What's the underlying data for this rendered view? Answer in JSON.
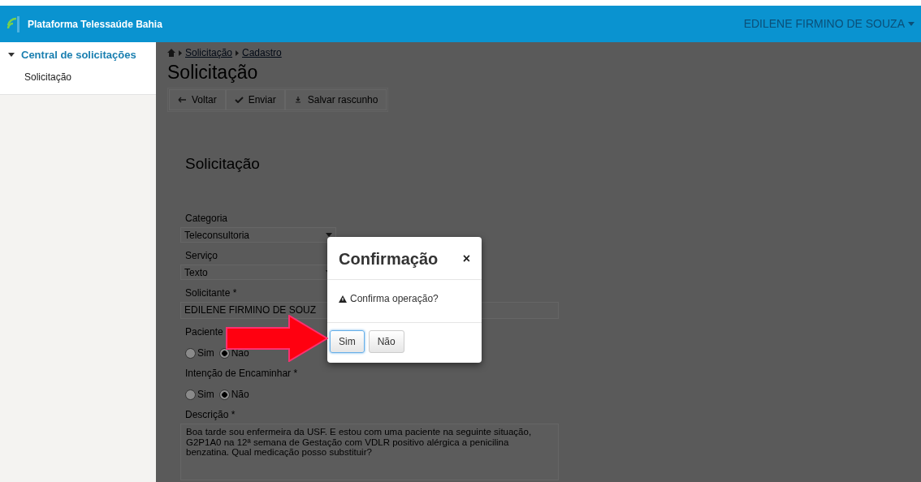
{
  "navbar": {
    "brand": "Plataforma Telessaúde Bahia",
    "user": "EDILENE FIRMINO DE SOUZA"
  },
  "sidebar": {
    "items": [
      {
        "label": "Central de solicitações",
        "expanded": true,
        "children": [
          {
            "label": "Solicitação"
          }
        ]
      }
    ]
  },
  "breadcrumb": [
    "Solicitação",
    "Cadastro"
  ],
  "page_title": "Solicitação",
  "toolbar": [
    {
      "kind": "back",
      "label": "Voltar"
    },
    {
      "kind": "send",
      "label": "Enviar"
    },
    {
      "kind": "save",
      "label": "Salvar rascunho"
    }
  ],
  "form": {
    "title": "Solicitação",
    "fields": [
      {
        "kind": "select",
        "label": "Categoria",
        "value": "Teleconsultoria"
      },
      {
        "kind": "select",
        "label": "Serviço",
        "value": "Texto"
      },
      {
        "kind": "text",
        "label": "Solicitante *",
        "value": "EDILENE FIRMINO DE SOUZ"
      },
      {
        "kind": "radio",
        "label": "Paciente",
        "options": [
          {
            "label": "Sim",
            "selected": false
          },
          {
            "label": "Não",
            "selected": true
          }
        ]
      },
      {
        "kind": "radio",
        "label": "Intenção de Encaminhar *",
        "options": [
          {
            "label": "Sim",
            "selected": false
          },
          {
            "label": "Não",
            "selected": true
          }
        ]
      },
      {
        "kind": "textarea",
        "label": "Descrição *",
        "value": "Boa tarde sou enfermeira da USF. E estou com uma paciente na seguinte situação,  G2P1A0 na 12ª semana de Gestação com VDLR positivo alérgica a penicilina benzatina. Qual medicação posso substituir?"
      }
    ]
  },
  "modal": {
    "title": "Confirmação",
    "close": "×",
    "message": "Confirma operação?",
    "buttons": [
      {
        "label": "Sim",
        "selected": true
      },
      {
        "label": "Não",
        "selected": false
      }
    ]
  }
}
